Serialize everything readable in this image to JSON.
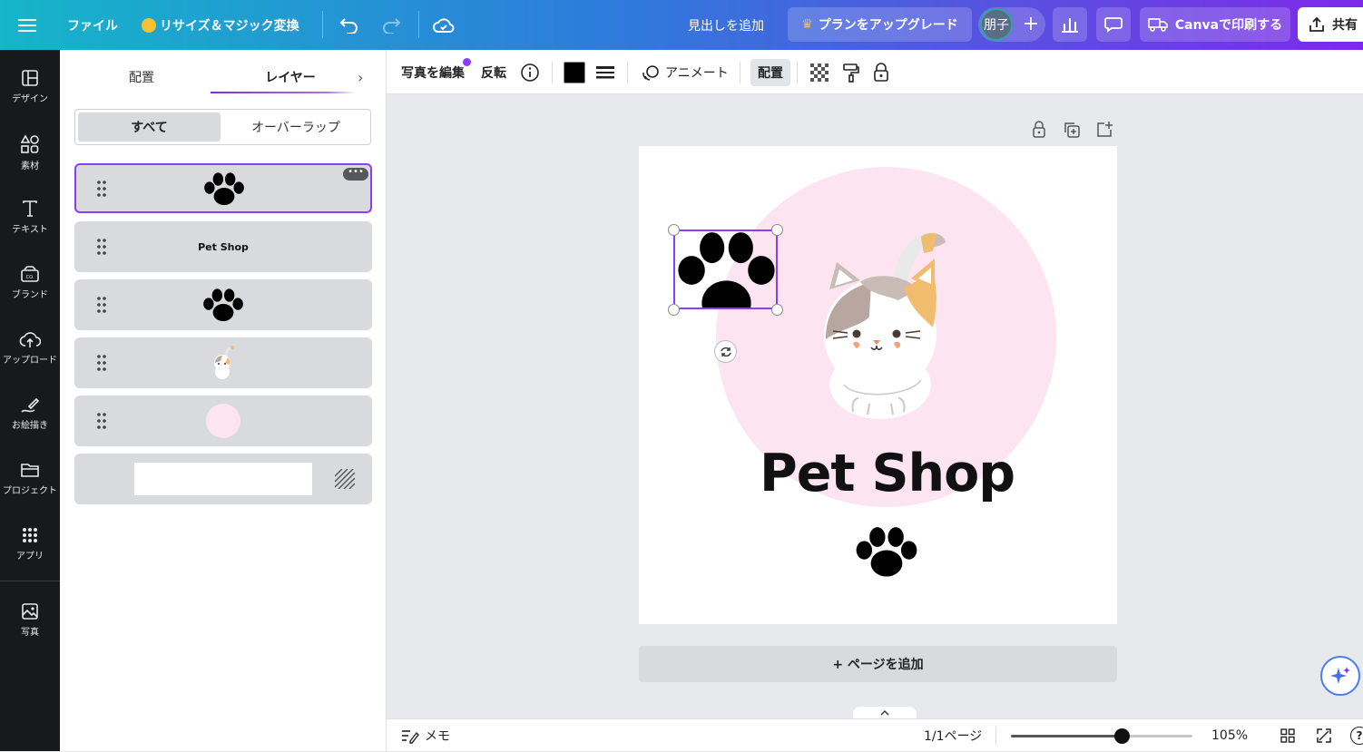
{
  "topbar": {
    "file": "ファイル",
    "resize": "リサイズ＆マジック変換",
    "add_heading": "見出しを追加",
    "upgrade": "プランをアップグレード",
    "avatar": "朋子",
    "print": "Canvaで印刷する",
    "share": "共有"
  },
  "sidebar": {
    "items": [
      {
        "label": "デザイン",
        "icon": "layout-icon"
      },
      {
        "label": "素材",
        "icon": "shapes-icon"
      },
      {
        "label": "テキスト",
        "icon": "text-icon"
      },
      {
        "label": "ブランド",
        "icon": "brand-icon"
      },
      {
        "label": "アップロード",
        "icon": "upload-icon"
      },
      {
        "label": "お絵描き",
        "icon": "draw-icon"
      },
      {
        "label": "プロジェクト",
        "icon": "folder-icon"
      },
      {
        "label": "アプリ",
        "icon": "apps-icon"
      },
      {
        "label": "写真",
        "icon": "photo-icon"
      }
    ]
  },
  "panel": {
    "tabs": [
      "配置",
      "レイヤー"
    ],
    "filter": [
      "すべて",
      "オーバーラップ"
    ],
    "layers": [
      {
        "label": "",
        "kind": "paw"
      },
      {
        "label": "Pet Shop",
        "kind": "text"
      },
      {
        "label": "",
        "kind": "paw"
      },
      {
        "label": "",
        "kind": "cat"
      },
      {
        "label": "",
        "kind": "circle"
      },
      {
        "label": "",
        "kind": "background"
      }
    ]
  },
  "toolbar": {
    "edit_photo": "写真を編集",
    "flip": "反転",
    "animate": "アニメート",
    "position": "配置",
    "color": "#000000"
  },
  "canvas": {
    "title": "Pet Shop",
    "circle_color": "#fce4f0",
    "add_page": "+ ページを追加"
  },
  "bottombar": {
    "notes": "メモ",
    "pages": "1/1ページ",
    "zoom": "105%",
    "zoom_level": 0.61
  },
  "colors": {
    "accent": "#7d2ae8",
    "sidebar_bg": "#18191b"
  }
}
